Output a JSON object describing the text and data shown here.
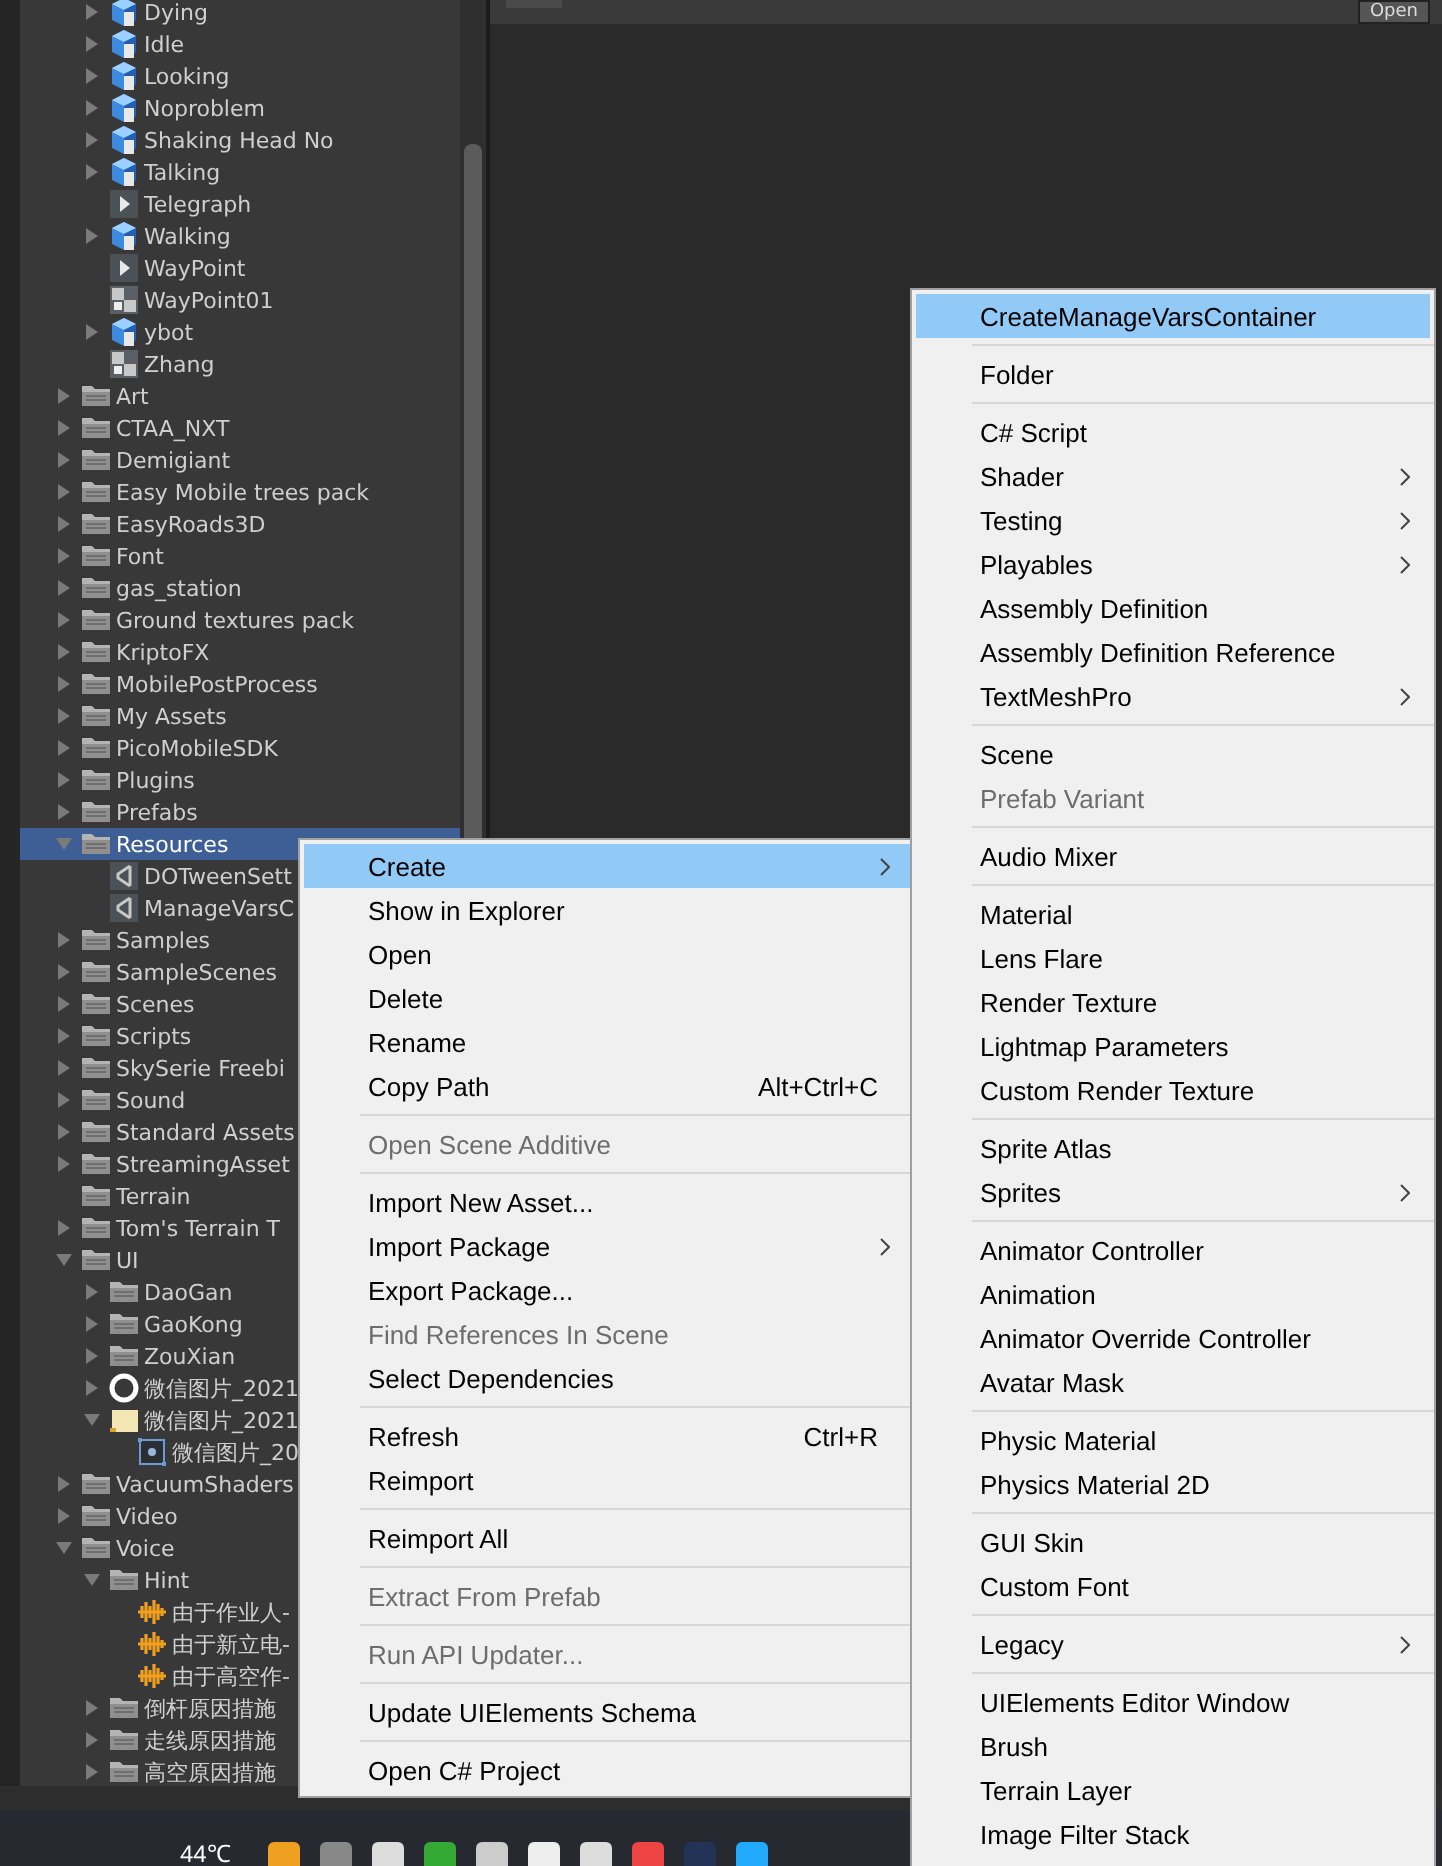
{
  "scene_view": {
    "open_button": "Open"
  },
  "project_tree": {
    "continued_items": [
      {
        "label": "Dying",
        "kind": "model",
        "expanded": false,
        "selected": false
      },
      {
        "label": "Idle",
        "kind": "model",
        "expanded": false,
        "selected": false
      },
      {
        "label": "Looking",
        "kind": "model",
        "expanded": false,
        "selected": false
      },
      {
        "label": "Noproblem",
        "kind": "model",
        "expanded": false,
        "selected": false
      },
      {
        "label": "Shaking Head No",
        "kind": "model",
        "expanded": false,
        "selected": false
      },
      {
        "label": "Talking",
        "kind": "model",
        "expanded": false,
        "selected": false
      },
      {
        "label": "Telegraph",
        "kind": "clip",
        "selected": false
      },
      {
        "label": "Walking",
        "kind": "model",
        "expanded": false,
        "selected": false
      },
      {
        "label": "WayPoint",
        "kind": "clip",
        "selected": false
      },
      {
        "label": "WayPoint01",
        "kind": "image",
        "selected": false
      },
      {
        "label": "ybot",
        "kind": "model",
        "expanded": false,
        "selected": false
      },
      {
        "label": "Zhang",
        "kind": "image",
        "selected": false
      }
    ],
    "items": [
      {
        "label": "Art",
        "kind": "folder",
        "expanded": false,
        "selected": false
      },
      {
        "label": "CTAA_NXT",
        "kind": "folder",
        "expanded": false,
        "selected": false
      },
      {
        "label": "Demigiant",
        "kind": "folder",
        "expanded": false,
        "selected": false
      },
      {
        "label": "Easy Mobile trees pack",
        "kind": "folder",
        "expanded": false,
        "selected": false
      },
      {
        "label": "EasyRoads3D",
        "kind": "folder",
        "expanded": false,
        "selected": false
      },
      {
        "label": "Font",
        "kind": "folder",
        "expanded": false,
        "selected": false
      },
      {
        "label": "gas_station",
        "kind": "folder",
        "expanded": false,
        "selected": false
      },
      {
        "label": "Ground textures pack",
        "kind": "folder",
        "expanded": false,
        "selected": false
      },
      {
        "label": "KriptoFX",
        "kind": "folder",
        "expanded": false,
        "selected": false
      },
      {
        "label": "MobilePostProcess",
        "kind": "folder",
        "expanded": false,
        "selected": false
      },
      {
        "label": "My Assets",
        "kind": "folder",
        "expanded": false,
        "selected": false
      },
      {
        "label": "PicoMobileSDK",
        "kind": "folder",
        "expanded": false,
        "selected": false
      },
      {
        "label": "Plugins",
        "kind": "folder",
        "expanded": false,
        "selected": false
      },
      {
        "label": "Prefabs",
        "kind": "folder",
        "expanded": false,
        "selected": false
      },
      {
        "label": "Resources",
        "kind": "folder",
        "expanded": true,
        "selected": true,
        "children": [
          {
            "label": "DOTweenSett",
            "kind": "script",
            "selected": false
          },
          {
            "label": "ManageVarsC",
            "kind": "script",
            "selected": false
          }
        ]
      },
      {
        "label": "Samples",
        "kind": "folder",
        "expanded": false,
        "selected": false
      },
      {
        "label": "SampleScenes",
        "kind": "folder",
        "expanded": false,
        "selected": false
      },
      {
        "label": "Scenes",
        "kind": "folder",
        "expanded": false,
        "selected": false
      },
      {
        "label": "Scripts",
        "kind": "folder",
        "expanded": false,
        "selected": false
      },
      {
        "label": "SkySerie Freebi",
        "kind": "folder",
        "expanded": false,
        "selected": false
      },
      {
        "label": "Sound",
        "kind": "folder",
        "expanded": false,
        "selected": false
      },
      {
        "label": "Standard Assets",
        "kind": "folder",
        "expanded": false,
        "selected": false
      },
      {
        "label": "StreamingAsset",
        "kind": "folder",
        "expanded": false,
        "selected": false
      },
      {
        "label": "Terrain",
        "kind": "folder",
        "selected": false
      },
      {
        "label": "Tom's Terrain T",
        "kind": "folder",
        "expanded": false,
        "selected": false
      },
      {
        "label": "UI",
        "kind": "folder",
        "expanded": true,
        "selected": false,
        "children": [
          {
            "label": "DaoGan",
            "kind": "folder",
            "expanded": false,
            "selected": false
          },
          {
            "label": "GaoKong",
            "kind": "folder",
            "expanded": false,
            "selected": false
          },
          {
            "label": "ZouXian",
            "kind": "folder",
            "expanded": false,
            "selected": false
          },
          {
            "label": "微信图片_2021",
            "kind": "ring",
            "expanded": false,
            "selected": false
          },
          {
            "label": "微信图片_2021",
            "kind": "sprite",
            "expanded": true,
            "selected": false,
            "children": [
              {
                "label": "微信图片_20",
                "kind": "frame",
                "selected": false
              }
            ]
          }
        ]
      },
      {
        "label": "VacuumShaders",
        "kind": "folder",
        "expanded": false,
        "selected": false
      },
      {
        "label": "Video",
        "kind": "folder",
        "expanded": false,
        "selected": false
      },
      {
        "label": "Voice",
        "kind": "folder",
        "expanded": true,
        "selected": false,
        "children": [
          {
            "label": "Hint",
            "kind": "folder",
            "expanded": true,
            "selected": false,
            "children": [
              {
                "label": "由于作业人-",
                "kind": "audio",
                "selected": false
              },
              {
                "label": "由于新立电-",
                "kind": "audio",
                "selected": false
              },
              {
                "label": "由于高空作-",
                "kind": "audio",
                "selected": false
              }
            ]
          },
          {
            "label": "倒杆原因措施",
            "kind": "folder",
            "expanded": false,
            "selected": false
          },
          {
            "label": "走线原因措施",
            "kind": "folder",
            "expanded": false,
            "selected": false
          },
          {
            "label": "高空原因措施",
            "kind": "folder",
            "expanded": false,
            "selected": false
          }
        ]
      }
    ]
  },
  "context_menu": {
    "items": [
      {
        "kind": "item",
        "label": "Create",
        "highlighted": true,
        "disabled": false,
        "submenu": true
      },
      {
        "kind": "item",
        "label": "Show in Explorer",
        "highlighted": false,
        "disabled": false,
        "submenu": false
      },
      {
        "kind": "item",
        "label": "Open",
        "highlighted": false,
        "disabled": false,
        "submenu": false
      },
      {
        "kind": "item",
        "label": "Delete",
        "highlighted": false,
        "disabled": false,
        "submenu": false
      },
      {
        "kind": "item",
        "label": "Rename",
        "highlighted": false,
        "disabled": false,
        "submenu": false
      },
      {
        "kind": "item",
        "label": "Copy Path",
        "shortcut": "Alt+Ctrl+C",
        "highlighted": false,
        "disabled": false,
        "submenu": false
      },
      {
        "kind": "separator"
      },
      {
        "kind": "item",
        "label": "Open Scene Additive",
        "highlighted": false,
        "disabled": true,
        "submenu": false
      },
      {
        "kind": "separator"
      },
      {
        "kind": "item",
        "label": "Import New Asset...",
        "highlighted": false,
        "disabled": false,
        "submenu": false
      },
      {
        "kind": "item",
        "label": "Import Package",
        "highlighted": false,
        "disabled": false,
        "submenu": true
      },
      {
        "kind": "item",
        "label": "Export Package...",
        "highlighted": false,
        "disabled": false,
        "submenu": false
      },
      {
        "kind": "item",
        "label": "Find References In Scene",
        "highlighted": false,
        "disabled": true,
        "submenu": false
      },
      {
        "kind": "item",
        "label": "Select Dependencies",
        "highlighted": false,
        "disabled": false,
        "submenu": false
      },
      {
        "kind": "separator"
      },
      {
        "kind": "item",
        "label": "Refresh",
        "shortcut": "Ctrl+R",
        "highlighted": false,
        "disabled": false,
        "submenu": false
      },
      {
        "kind": "item",
        "label": "Reimport",
        "highlighted": false,
        "disabled": false,
        "submenu": false
      },
      {
        "kind": "separator"
      },
      {
        "kind": "item",
        "label": "Reimport All",
        "highlighted": false,
        "disabled": false,
        "submenu": false
      },
      {
        "kind": "separator"
      },
      {
        "kind": "item",
        "label": "Extract From Prefab",
        "highlighted": false,
        "disabled": true,
        "submenu": false
      },
      {
        "kind": "separator"
      },
      {
        "kind": "item",
        "label": "Run API Updater...",
        "highlighted": false,
        "disabled": true,
        "submenu": false
      },
      {
        "kind": "separator"
      },
      {
        "kind": "item",
        "label": "Update UIElements Schema",
        "highlighted": false,
        "disabled": false,
        "submenu": false
      },
      {
        "kind": "separator"
      },
      {
        "kind": "item",
        "label": "Open C# Project",
        "highlighted": false,
        "disabled": false,
        "submenu": false
      }
    ]
  },
  "create_submenu": {
    "items": [
      {
        "kind": "item",
        "label": "CreateManageVarsContainer",
        "highlighted": true,
        "disabled": false,
        "submenu": false
      },
      {
        "kind": "separator"
      },
      {
        "kind": "item",
        "label": "Folder",
        "highlighted": false,
        "disabled": false,
        "submenu": false
      },
      {
        "kind": "separator"
      },
      {
        "kind": "item",
        "label": "C# Script",
        "highlighted": false,
        "disabled": false,
        "submenu": false
      },
      {
        "kind": "item",
        "label": "Shader",
        "highlighted": false,
        "disabled": false,
        "submenu": true
      },
      {
        "kind": "item",
        "label": "Testing",
        "highlighted": false,
        "disabled": false,
        "submenu": true
      },
      {
        "kind": "item",
        "label": "Playables",
        "highlighted": false,
        "disabled": false,
        "submenu": true
      },
      {
        "kind": "item",
        "label": "Assembly Definition",
        "highlighted": false,
        "disabled": false,
        "submenu": false
      },
      {
        "kind": "item",
        "label": "Assembly Definition Reference",
        "highlighted": false,
        "disabled": false,
        "submenu": false
      },
      {
        "kind": "item",
        "label": "TextMeshPro",
        "highlighted": false,
        "disabled": false,
        "submenu": true
      },
      {
        "kind": "separator"
      },
      {
        "kind": "item",
        "label": "Scene",
        "highlighted": false,
        "disabled": false,
        "submenu": false
      },
      {
        "kind": "item",
        "label": "Prefab Variant",
        "highlighted": false,
        "disabled": true,
        "submenu": false
      },
      {
        "kind": "separator"
      },
      {
        "kind": "item",
        "label": "Audio Mixer",
        "highlighted": false,
        "disabled": false,
        "submenu": false
      },
      {
        "kind": "separator"
      },
      {
        "kind": "item",
        "label": "Material",
        "highlighted": false,
        "disabled": false,
        "submenu": false
      },
      {
        "kind": "item",
        "label": "Lens Flare",
        "highlighted": false,
        "disabled": false,
        "submenu": false
      },
      {
        "kind": "item",
        "label": "Render Texture",
        "highlighted": false,
        "disabled": false,
        "submenu": false
      },
      {
        "kind": "item",
        "label": "Lightmap Parameters",
        "highlighted": false,
        "disabled": false,
        "submenu": false
      },
      {
        "kind": "item",
        "label": "Custom Render Texture",
        "highlighted": false,
        "disabled": false,
        "submenu": false
      },
      {
        "kind": "separator"
      },
      {
        "kind": "item",
        "label": "Sprite Atlas",
        "highlighted": false,
        "disabled": false,
        "submenu": false
      },
      {
        "kind": "item",
        "label": "Sprites",
        "highlighted": false,
        "disabled": false,
        "submenu": true
      },
      {
        "kind": "separator"
      },
      {
        "kind": "item",
        "label": "Animator Controller",
        "highlighted": false,
        "disabled": false,
        "submenu": false
      },
      {
        "kind": "item",
        "label": "Animation",
        "highlighted": false,
        "disabled": false,
        "submenu": false
      },
      {
        "kind": "item",
        "label": "Animator Override Controller",
        "highlighted": false,
        "disabled": false,
        "submenu": false
      },
      {
        "kind": "item",
        "label": "Avatar Mask",
        "highlighted": false,
        "disabled": false,
        "submenu": false
      },
      {
        "kind": "separator"
      },
      {
        "kind": "item",
        "label": "Physic Material",
        "highlighted": false,
        "disabled": false,
        "submenu": false
      },
      {
        "kind": "item",
        "label": "Physics Material 2D",
        "highlighted": false,
        "disabled": false,
        "submenu": false
      },
      {
        "kind": "separator"
      },
      {
        "kind": "item",
        "label": "GUI Skin",
        "highlighted": false,
        "disabled": false,
        "submenu": false
      },
      {
        "kind": "item",
        "label": "Custom Font",
        "highlighted": false,
        "disabled": false,
        "submenu": false
      },
      {
        "kind": "separator"
      },
      {
        "kind": "item",
        "label": "Legacy",
        "highlighted": false,
        "disabled": false,
        "submenu": true
      },
      {
        "kind": "separator"
      },
      {
        "kind": "item",
        "label": "UIElements Editor Window",
        "highlighted": false,
        "disabled": false,
        "submenu": false
      },
      {
        "kind": "item",
        "label": "Brush",
        "highlighted": false,
        "disabled": false,
        "submenu": false
      },
      {
        "kind": "item",
        "label": "Terrain Layer",
        "highlighted": false,
        "disabled": false,
        "submenu": false
      },
      {
        "kind": "item",
        "label": "Image Filter Stack",
        "highlighted": false,
        "disabled": false,
        "submenu": false
      }
    ]
  },
  "taskbar": {
    "temperature": "44℃"
  }
}
